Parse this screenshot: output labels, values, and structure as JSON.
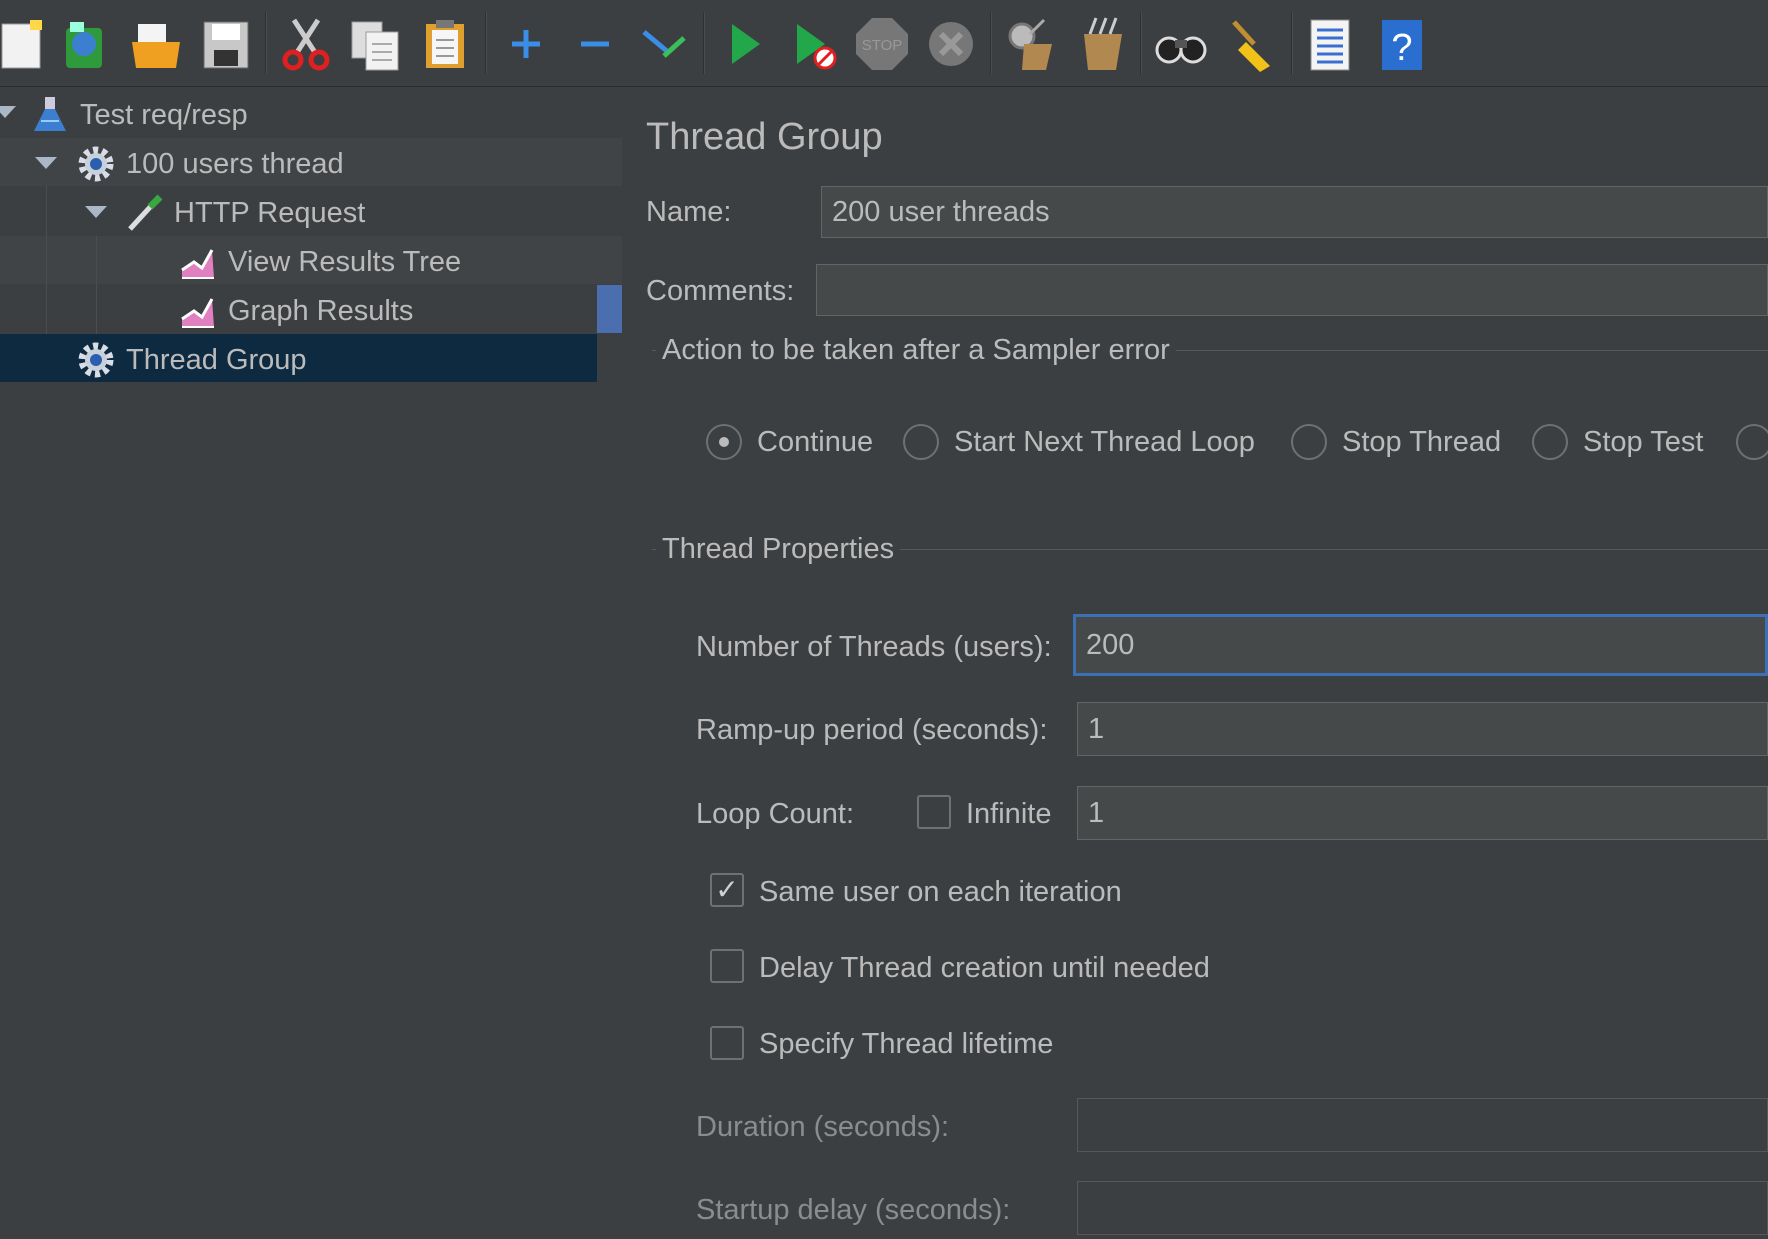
{
  "toolbar": {
    "icons": [
      "new-icon",
      "templates-icon",
      "open-icon",
      "save-icon",
      "cut-icon",
      "copy-icon",
      "paste-icon",
      "expand-icon",
      "collapse-icon",
      "toggle-icon",
      "start-icon",
      "start-no-timers-icon",
      "stop-icon",
      "shutdown-icon",
      "clear-icon",
      "clear-all-icon",
      "search-icon",
      "reset-search-icon",
      "function-helper-icon",
      "help-icon"
    ]
  },
  "tree": {
    "items": [
      {
        "label": "Test req/resp",
        "icon": "test-plan-icon"
      },
      {
        "label": "100 users thread",
        "icon": "gear-icon"
      },
      {
        "label": "HTTP Request",
        "icon": "pipette-icon"
      },
      {
        "label": "View Results Tree",
        "icon": "graph-icon"
      },
      {
        "label": "Graph Results",
        "icon": "graph-icon"
      },
      {
        "label": "Thread Group",
        "icon": "gear-icon",
        "selected": true
      }
    ]
  },
  "form": {
    "title": "Thread Group",
    "name_label": "Name:",
    "name_value": "200 user threads",
    "comments_label": "Comments:",
    "comments_value": "",
    "sampler_error": {
      "legend": "Action to be taken after a Sampler error",
      "options": [
        "Continue",
        "Start Next Thread Loop",
        "Stop Thread",
        "Stop Test"
      ],
      "selected": "Continue"
    },
    "thread_props": {
      "legend": "Thread Properties",
      "threads_label": "Number of Threads (users):",
      "threads_value": "200",
      "rampup_label": "Ramp-up period (seconds):",
      "rampup_value": "1",
      "loop_label": "Loop Count:",
      "infinite_label": "Infinite",
      "infinite_checked": false,
      "loop_value": "1",
      "same_user_label": "Same user on each iteration",
      "same_user_checked": true,
      "delay_label": "Delay Thread creation until needed",
      "delay_checked": false,
      "lifetime_label": "Specify Thread lifetime",
      "lifetime_checked": false,
      "duration_label": "Duration (seconds):",
      "duration_value": "",
      "startup_label": "Startup delay (seconds):",
      "startup_value": ""
    }
  },
  "colors": {
    "background": "#3c3f41",
    "selection": "#0d2a40",
    "focus_border": "#3d6fb4",
    "text": "#bbbbbb"
  }
}
